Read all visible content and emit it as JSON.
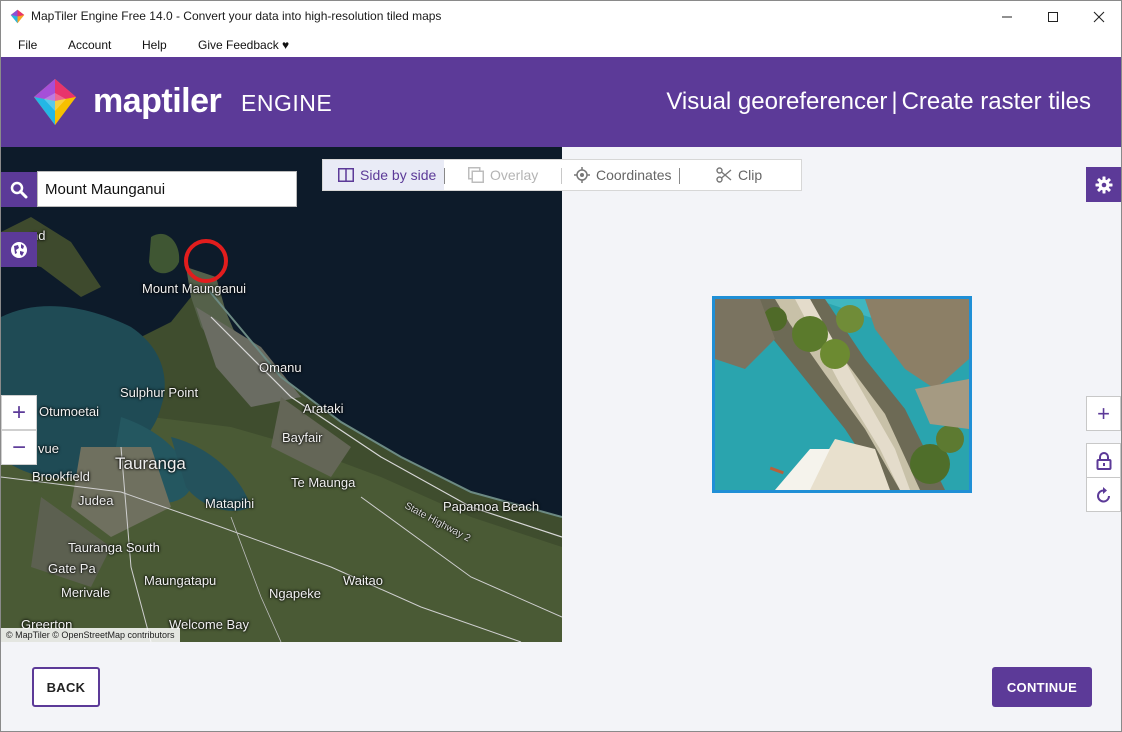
{
  "window": {
    "title": "MapTiler Engine Free 14.0 - Convert your data into high-resolution tiled maps"
  },
  "menu": {
    "file": "File",
    "account": "Account",
    "help": "Help",
    "feedback": "Give Feedback ♥"
  },
  "header": {
    "logo_word": "maptiler",
    "logo_engine": "ENGINE",
    "title_left": "Visual georeferencer",
    "title_sep": "|",
    "title_right": "Create raster tiles"
  },
  "colors": {
    "brand_purple": "#5c3a98",
    "marker_red": "#e21d1d",
    "preview_border": "#1f8fd6"
  },
  "map": {
    "search_value": "Mount Maunganui",
    "attribution": "© MapTiler © OpenStreetMap contributors",
    "zoom_in": "+",
    "zoom_out": "−",
    "labels": [
      "Mount Maunganui",
      "Omanu",
      "Sulphur Point",
      "Otumoetai",
      "Arataki",
      "Bayfair",
      "Tauranga",
      "Brookfield",
      "Judea",
      "Te Maunga",
      "Matapihi",
      "Papamoa Beach",
      "Tauranga South",
      "Gate Pa",
      "Merivale",
      "Maungatapu",
      "Ngapeke",
      "Waitao",
      "Welcome Bay",
      "Greerton",
      "State Highway 2",
      "vue",
      "nd"
    ]
  },
  "toolbar": {
    "side_by_side": "Side by side",
    "overlay": "Overlay",
    "coordinates": "Coordinates",
    "clip": "Clip"
  },
  "image_controls": {
    "zoom_in": "+"
  },
  "footer": {
    "back": "BACK",
    "continue": "CONTINUE"
  }
}
